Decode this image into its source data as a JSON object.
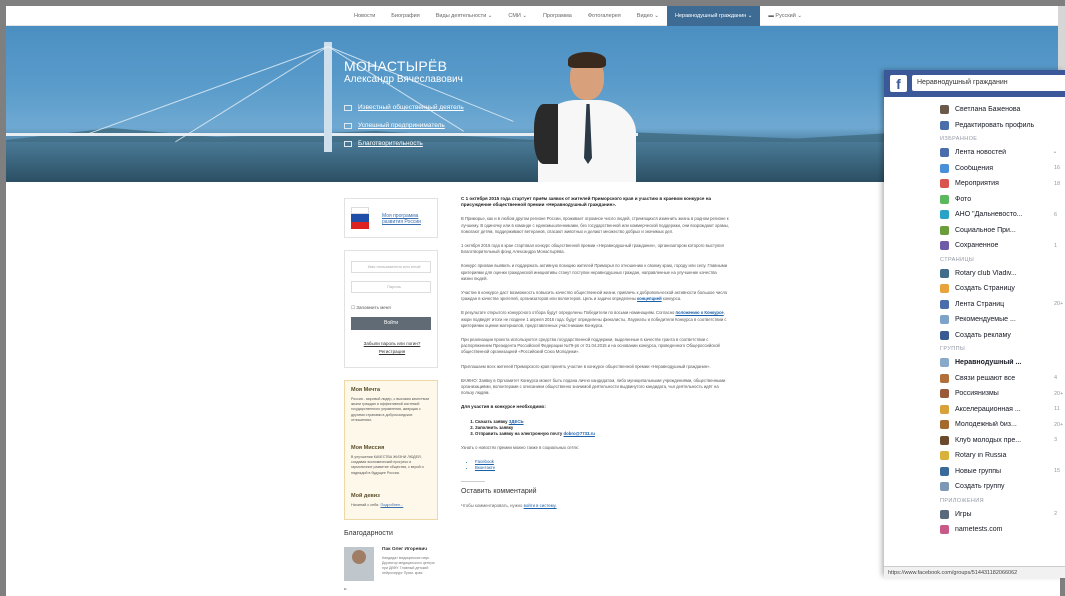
{
  "nav": {
    "items": [
      {
        "label": "Новости",
        "active": false
      },
      {
        "label": "Биография",
        "active": false
      },
      {
        "label": "Виды деятельности ⌄",
        "active": false
      },
      {
        "label": "СМИ ⌄",
        "active": false
      },
      {
        "label": "Программа",
        "active": false
      },
      {
        "label": "Фотогалерея",
        "active": false
      },
      {
        "label": "Видео ⌄",
        "active": false
      },
      {
        "label": "Неравнодушный гражданин ⌄",
        "active": true
      },
      {
        "label": "▬ Русский ⌄",
        "active": false
      }
    ]
  },
  "hero": {
    "surname": "МОНАСТЫРЁВ",
    "fullname": "Александр Вячеславович",
    "links": [
      "Известный общественный деятель",
      "Успешный предприниматель",
      "Благотворительность"
    ]
  },
  "sidebar": {
    "program_link": "Моя программа развития России",
    "login_placeholder": "Имя пользователя или email",
    "password_placeholder": "Пароль",
    "remember": "Запомнить меня",
    "login_button": "Войти",
    "forgot": "Забыли пароль или логин?",
    "register": "Регистрация",
    "dream_title": "Моя Мечта",
    "dream_text": "Россия - мировой лидер, с высоким качеством жизни граждан и эффективной системой государственного управления, живущая с другими странами в добрососедских отношениях.",
    "mission_title": "Моя Миссия",
    "mission_text": "В улучшении КАЧЕСТВА ЖИЗНИ ЛЮДЕЙ, создавая экономический прогресс и гармоничное развитие общества, с верой и надеждой в будущее России.",
    "motto_title": "Мой девиз",
    "motto_text": "Начинай с себя.",
    "motto_more": "Подробнее...",
    "thanks_title": "Благодарности",
    "thanks_name": "Пак Олег Игоревич",
    "thanks_desc": "Кандидат медицинских наук. Директор медицинского центра при ДВФУ. Главный детский нейрохирург Прим. края.",
    "thanks_quote": "“"
  },
  "article": {
    "intro": "С 1 октября 2015 года стартует приём заявок от жителей Приморского края и участию в краевом конкурсе на присуждение общественной премии «Неравнодушный гражданин».",
    "p1": "В Приморье, как и в любом другом регионе России, проживает огромное число людей, стремящихся изменить жизнь в родном регионе к лучшему. В одиночку или в команде с единомышленниками, без государственной или коммерческой поддержки, они возрождают храмы, помогают детям, поддерживают ветеранов, спасают животных и делают множество добрых и значимых дел.",
    "p2": "1 октября 2015 года в крае стартовал конкурс общественной премии «Неравнодушный гражданин», организатором которого выступил Благотворительный фонд Александра Монастырёва.",
    "p3": "Конкурс призван выявить и поддержать активную позицию жителей Приморья по отношению к своему краю, городу или селу. Главными критериями для оценки гражданской инициативы станут поступки неравнодушных граждан, направленные на улучшение качества жизни людей.",
    "p4a": "Участие в конкурсе даст возможность повысить качество общественной жизни, привлечь к добровольческой активности большое число граждан в качестве зрителей, организаторов или волонтеров. Цель и задачи определены ",
    "p4link": "концепцией",
    "p4b": " конкурса.",
    "p5a": "В результате открытого конкурсного отбора будут определены Победители по восьми номинациям. Согласно ",
    "p5link": "положению о Конкурсе",
    "p5b": ", жюри подведёт итоги не позднее 1 апреля 2016 года: будут определены финалисты, Лауреаты и победители Конкурса в соответствии с критериями оценки материалов, представленных участниками Конкурса.",
    "p6": "При реализации проекта используются средства государственной поддержки, выделенные в качестве гранта в соответствии с распоряжением Президента Российской Федерации №79-рп от 01.04.2015 и на основании конкурса, проведенного Общероссийской общественной организацией «Российский Союз Молодежи».",
    "p7": "Приглашаем всех жителей Приморского края принять участие в конкурсе общественной премии «Неравнодушный гражданин».",
    "p8": "ВАЖНО: Заявку в Оргкомитет Конкурса может быть подана лично кандидатом, либо муниципальными учреждениями, общественными организациями, волонтерами с описанием общественно значимой деятельности выдвинутого кандидата, чья деятельность идёт на пользу людям.",
    "need": "Для участия в конкурсе необходимо:",
    "step1a": "Скачать заявку ",
    "step1link": "ЗДЕСЬ",
    "step2": "Заполнить заявку",
    "step3a": "Отправить заявку на электронную почту ",
    "step3link": "dobro@7733.ru",
    "social": "Узнать о новостях премии можно также в социальных сетях:",
    "social_links": [
      "Facebook",
      "Вконтакте"
    ],
    "comment_title": "Оставить комментарий",
    "comment_text": "Чтобы комментировать, нужно ",
    "comment_link": "войти в систему."
  },
  "facebook": {
    "search": "Неравнодушный гражданин",
    "user": "Светлана Баженова",
    "edit_profile": "Редактировать профиль",
    "favorites_header": "ИЗБРАННОЕ",
    "favorites": [
      {
        "label": "Лента новостей",
        "count": "•",
        "color": "#4a6ea9"
      },
      {
        "label": "Сообщения",
        "count": "16",
        "color": "#4a90d9"
      },
      {
        "label": "Мероприятия",
        "count": "18",
        "color": "#d9534f"
      },
      {
        "label": "Фото",
        "count": "",
        "color": "#5cb85c"
      },
      {
        "label": "АНО \"Дальневосто...",
        "count": "6",
        "color": "#2aa2c8"
      },
      {
        "label": "Социальное При...",
        "count": "",
        "color": "#6a9e3c"
      },
      {
        "label": "Сохраненное",
        "count": "1",
        "color": "#6f5aa8"
      }
    ],
    "pages_header": "СТРАНИЦЫ",
    "pages": [
      {
        "label": "Rotary club Vladiv...",
        "count": "",
        "color": "#3f6d8a"
      },
      {
        "label": "Создать Страницу",
        "count": "",
        "color": "#e8a33c"
      },
      {
        "label": "Лента Страниц",
        "count": "20+",
        "color": "#4a6ea9"
      },
      {
        "label": "Рекомендуемые ...",
        "count": "",
        "color": "#7da3c9"
      },
      {
        "label": "Создать рекламу",
        "count": "",
        "color": "#3a5b91"
      }
    ],
    "groups_header": "ГРУППЫ",
    "groups": [
      {
        "label": "Неравнодушный ...",
        "count": "",
        "color": "#88a9c9",
        "bold": true
      },
      {
        "label": "Связи решают все",
        "count": "4",
        "color": "#b36f3a"
      },
      {
        "label": "Россиянизмы",
        "count": "20+",
        "color": "#9a5a3a"
      },
      {
        "label": "Акселерационная ...",
        "count": "11",
        "color": "#d8a13a"
      },
      {
        "label": "Молодежный биз...",
        "count": "20+",
        "color": "#a46a2d"
      },
      {
        "label": "Клуб молодых пре...",
        "count": "3",
        "color": "#6b4a2d"
      },
      {
        "label": "Rotary in Russia",
        "count": "",
        "color": "#d8b23a"
      },
      {
        "label": "Новые группы",
        "count": "15",
        "color": "#3a6a9a"
      },
      {
        "label": "Создать группу",
        "count": "",
        "color": "#7d98b6"
      }
    ],
    "apps_header": "ПРИЛОЖЕНИЯ",
    "apps": [
      {
        "label": "Игры",
        "count": "2",
        "color": "#5a6a7a"
      },
      {
        "label": "nametests.com",
        "count": "",
        "color": "#c85a8a"
      }
    ]
  },
  "statusbar": "https://www.facebook.com/groups/514431182066062",
  "colors": {
    "nav_active": "#3d6b94",
    "fb_blue": "#3b5998",
    "link": "#1a5faa"
  }
}
